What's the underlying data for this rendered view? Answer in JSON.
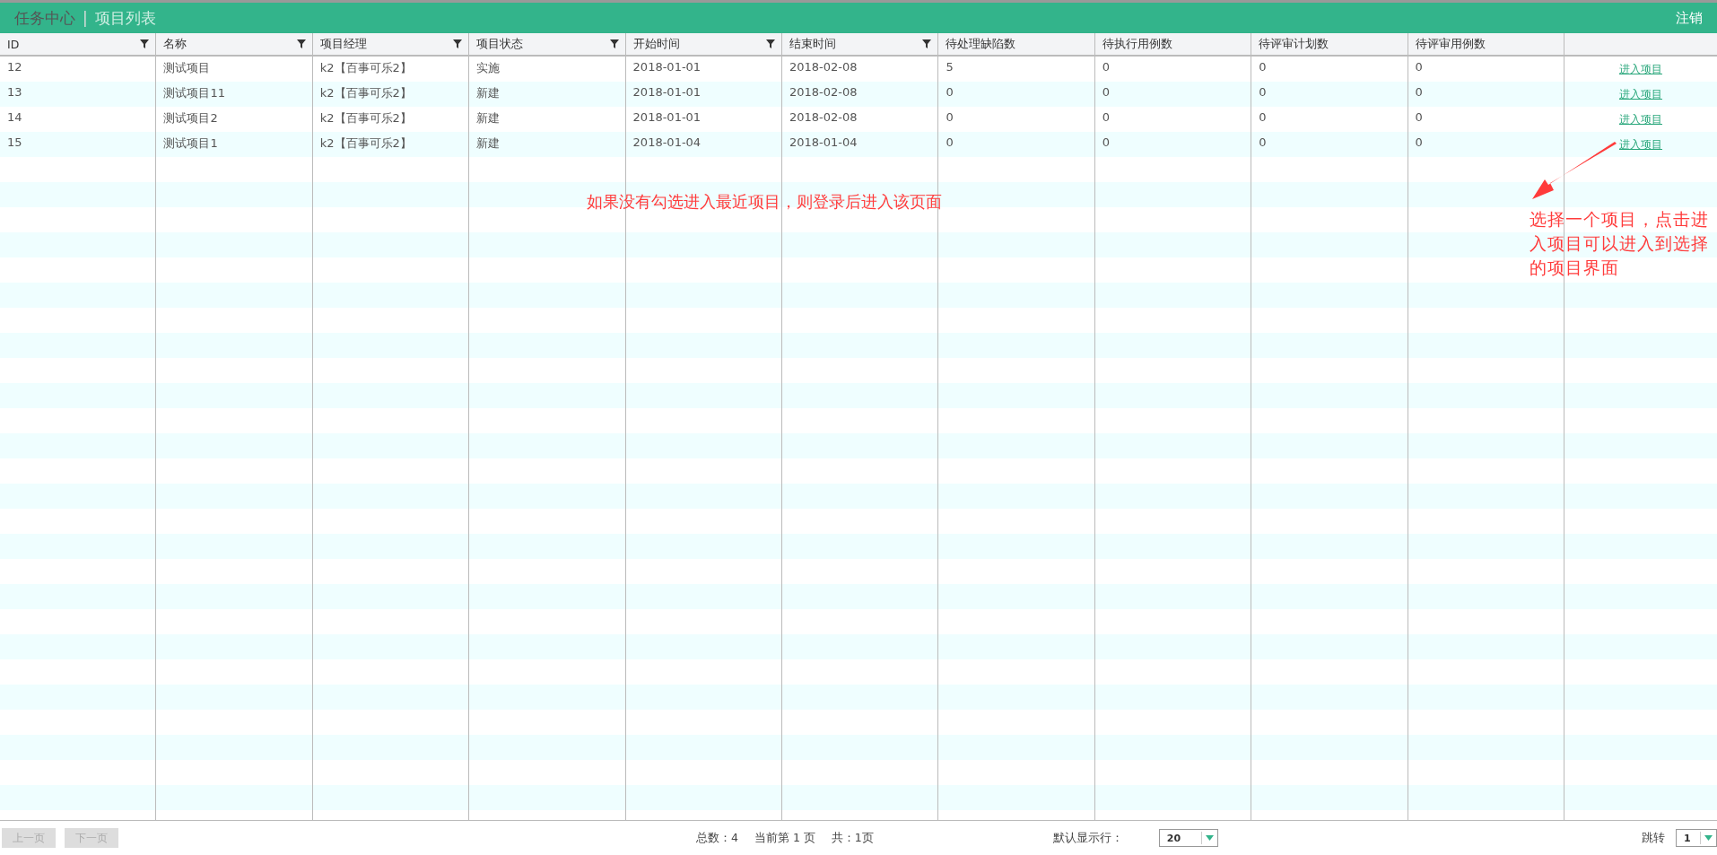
{
  "header": {
    "title": "任务中心",
    "separator": "|",
    "subtitle": "项目列表",
    "logout": "注销"
  },
  "table": {
    "columns": [
      {
        "label": "ID",
        "filter": true
      },
      {
        "label": "名称",
        "filter": true
      },
      {
        "label": "项目经理",
        "filter": true
      },
      {
        "label": "项目状态",
        "filter": true
      },
      {
        "label": "开始时间",
        "filter": true
      },
      {
        "label": "结束时间",
        "filter": true
      },
      {
        "label": "待处理缺陷数",
        "filter": false
      },
      {
        "label": "待执行用例数",
        "filter": false
      },
      {
        "label": "待评审计划数",
        "filter": false
      },
      {
        "label": "待评审用例数",
        "filter": false
      }
    ],
    "rows": [
      {
        "cells": [
          "12",
          "测试项目",
          "k2【百事可乐2】",
          "实施",
          "2018-01-01",
          "2018-02-08",
          "5",
          "0",
          "0",
          "0"
        ],
        "action": "进入项目"
      },
      {
        "cells": [
          "13",
          "测试项目11",
          "k2【百事可乐2】",
          "新建",
          "2018-01-01",
          "2018-02-08",
          "0",
          "0",
          "0",
          "0"
        ],
        "action": "进入项目"
      },
      {
        "cells": [
          "14",
          "测试项目2",
          "k2【百事可乐2】",
          "新建",
          "2018-01-01",
          "2018-02-08",
          "0",
          "0",
          "0",
          "0"
        ],
        "action": "进入项目"
      },
      {
        "cells": [
          "15",
          "测试项目1",
          "k2【百事可乐2】",
          "新建",
          "2018-01-04",
          "2018-01-04",
          "0",
          "0",
          "0",
          "0"
        ],
        "action": "进入项目"
      }
    ]
  },
  "annotations": {
    "center": "如果没有勾选进入最近项目，则登录后进入该页面",
    "right": "选择一个项目，点击进入项目可以进入到选择的项目界面"
  },
  "footer": {
    "prev": {
      "label": "上一页",
      "disabled": true
    },
    "next": {
      "label": "下一页",
      "disabled": true
    },
    "total": "总数：4",
    "current": "当前第 1 页",
    "pages": "共：1页",
    "rows_label": "默认显示行：",
    "rows_value": "20",
    "jump_label": "跳转",
    "jump_value": "1"
  }
}
